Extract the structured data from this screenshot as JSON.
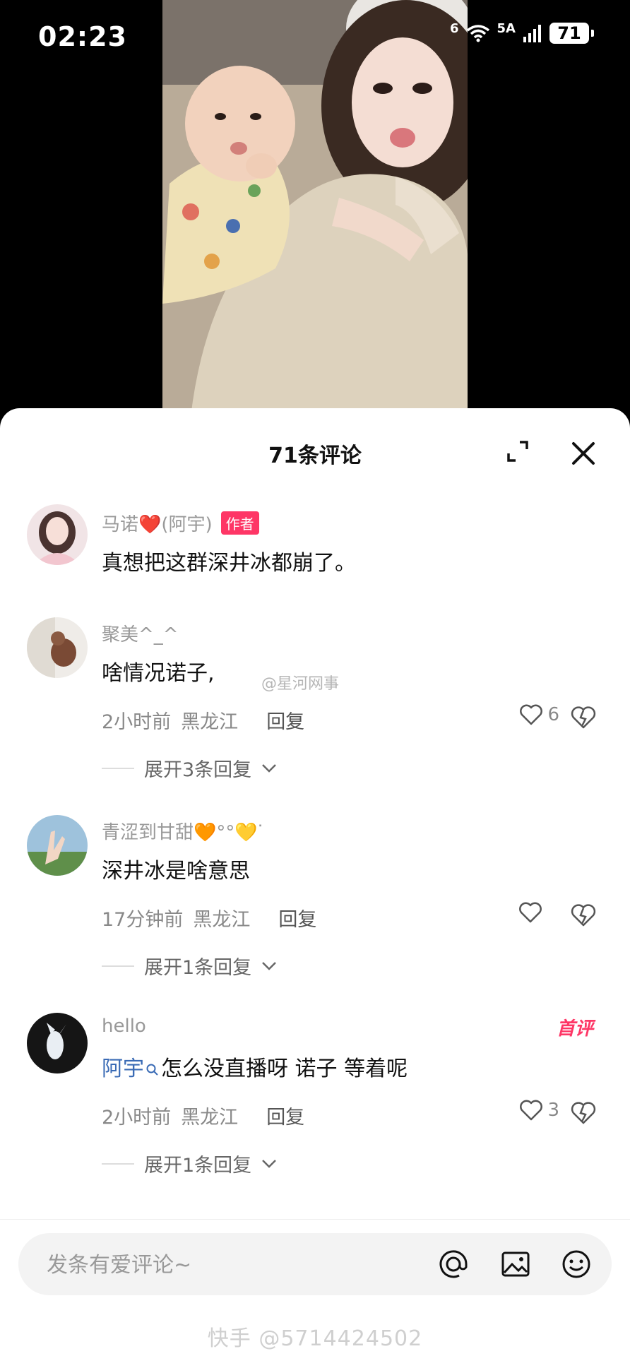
{
  "status_bar": {
    "time": "02:23",
    "network": "5A",
    "wifi": "6",
    "battery": "71"
  },
  "panel": {
    "title": "71条评论"
  },
  "comments": [
    {
      "name": "马诺❤️(阿宇)",
      "tag": "作者",
      "text": "真想把这群深井冰都崩了。"
    },
    {
      "name": "聚美^_^",
      "text": "啥情况诺子,",
      "time": "2小时前",
      "location": "黑龙江",
      "reply": "回复",
      "likes": "6",
      "expand": "展开3条回复"
    },
    {
      "name": "青涩到甘甜🧡°°💛ᐝ",
      "text": "深井冰是啥意思",
      "time": "17分钟前",
      "location": "黑龙江",
      "reply": "回复",
      "likes": "",
      "expand": "展开1条回复"
    },
    {
      "name": "hello",
      "badge": "首评",
      "mention": "阿宇",
      "text": "怎么没直播呀 诺子 等着呢",
      "time": "2小时前",
      "location": "黑龙江",
      "reply": "回复",
      "likes": "3",
      "expand": "展开1条回复"
    }
  ],
  "watermarks": {
    "middle": "@星河网事",
    "bottom": "快手 @5714424502"
  },
  "input": {
    "placeholder": "发条有爱评论~"
  },
  "icons": [
    "wifi-icon",
    "signal-icon",
    "expand-icon",
    "close-icon",
    "heart-icon",
    "dislike-icon",
    "chevron-down-icon",
    "at-icon",
    "image-icon",
    "emoji-icon",
    "search-icon"
  ]
}
